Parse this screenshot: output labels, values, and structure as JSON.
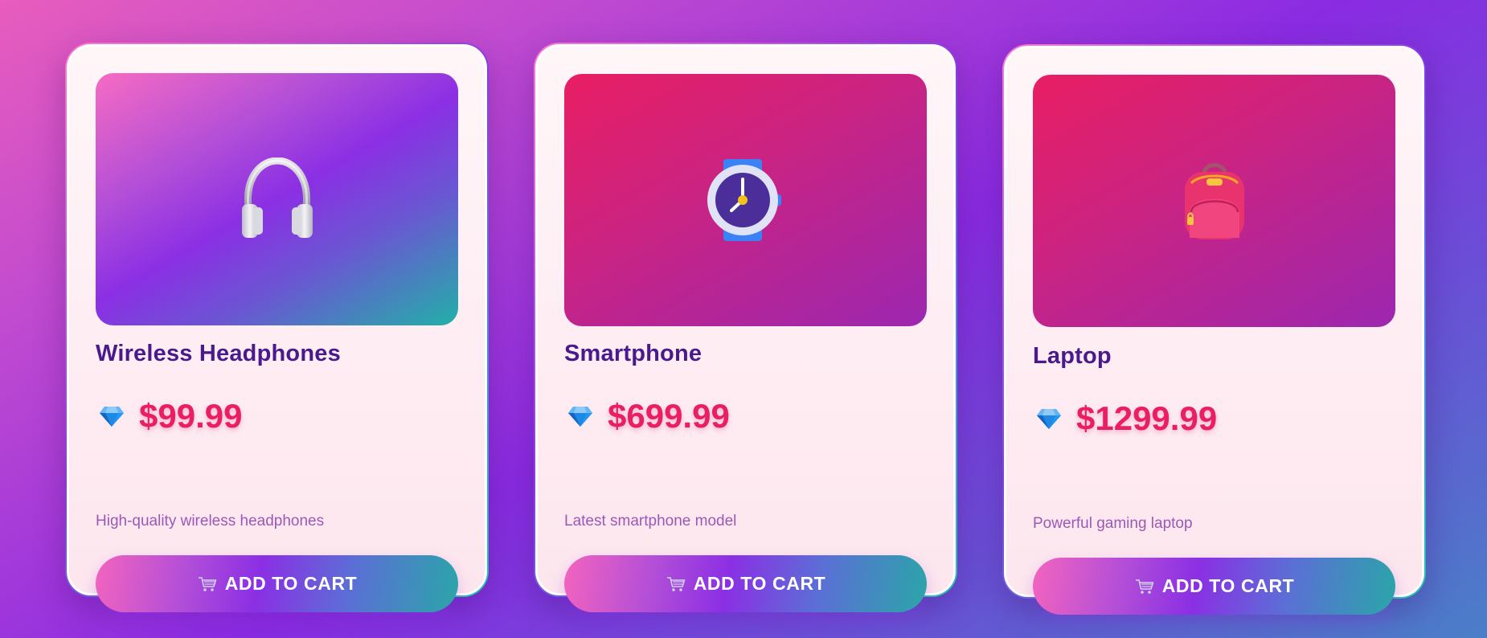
{
  "colors": {
    "title": "#4a1a8c",
    "price": "#e91e63",
    "description": "#9b59b6",
    "button_text": "#ffffff"
  },
  "products": [
    {
      "name": "Wireless Headphones",
      "price": "$99.99",
      "description": "High-quality wireless headphones",
      "button_label": "ADD TO CART",
      "image_icon": "headphone-icon",
      "price_icon": "gem-icon"
    },
    {
      "name": "Smartphone",
      "price": "$699.99",
      "description": "Latest smartphone model",
      "button_label": "ADD TO CART",
      "image_icon": "watch-icon",
      "price_icon": "gem-icon"
    },
    {
      "name": "Laptop",
      "price": "$1299.99",
      "description": "Powerful gaming laptop",
      "button_label": "ADD TO CART",
      "image_icon": "backpack-icon",
      "price_icon": "gem-icon"
    }
  ]
}
